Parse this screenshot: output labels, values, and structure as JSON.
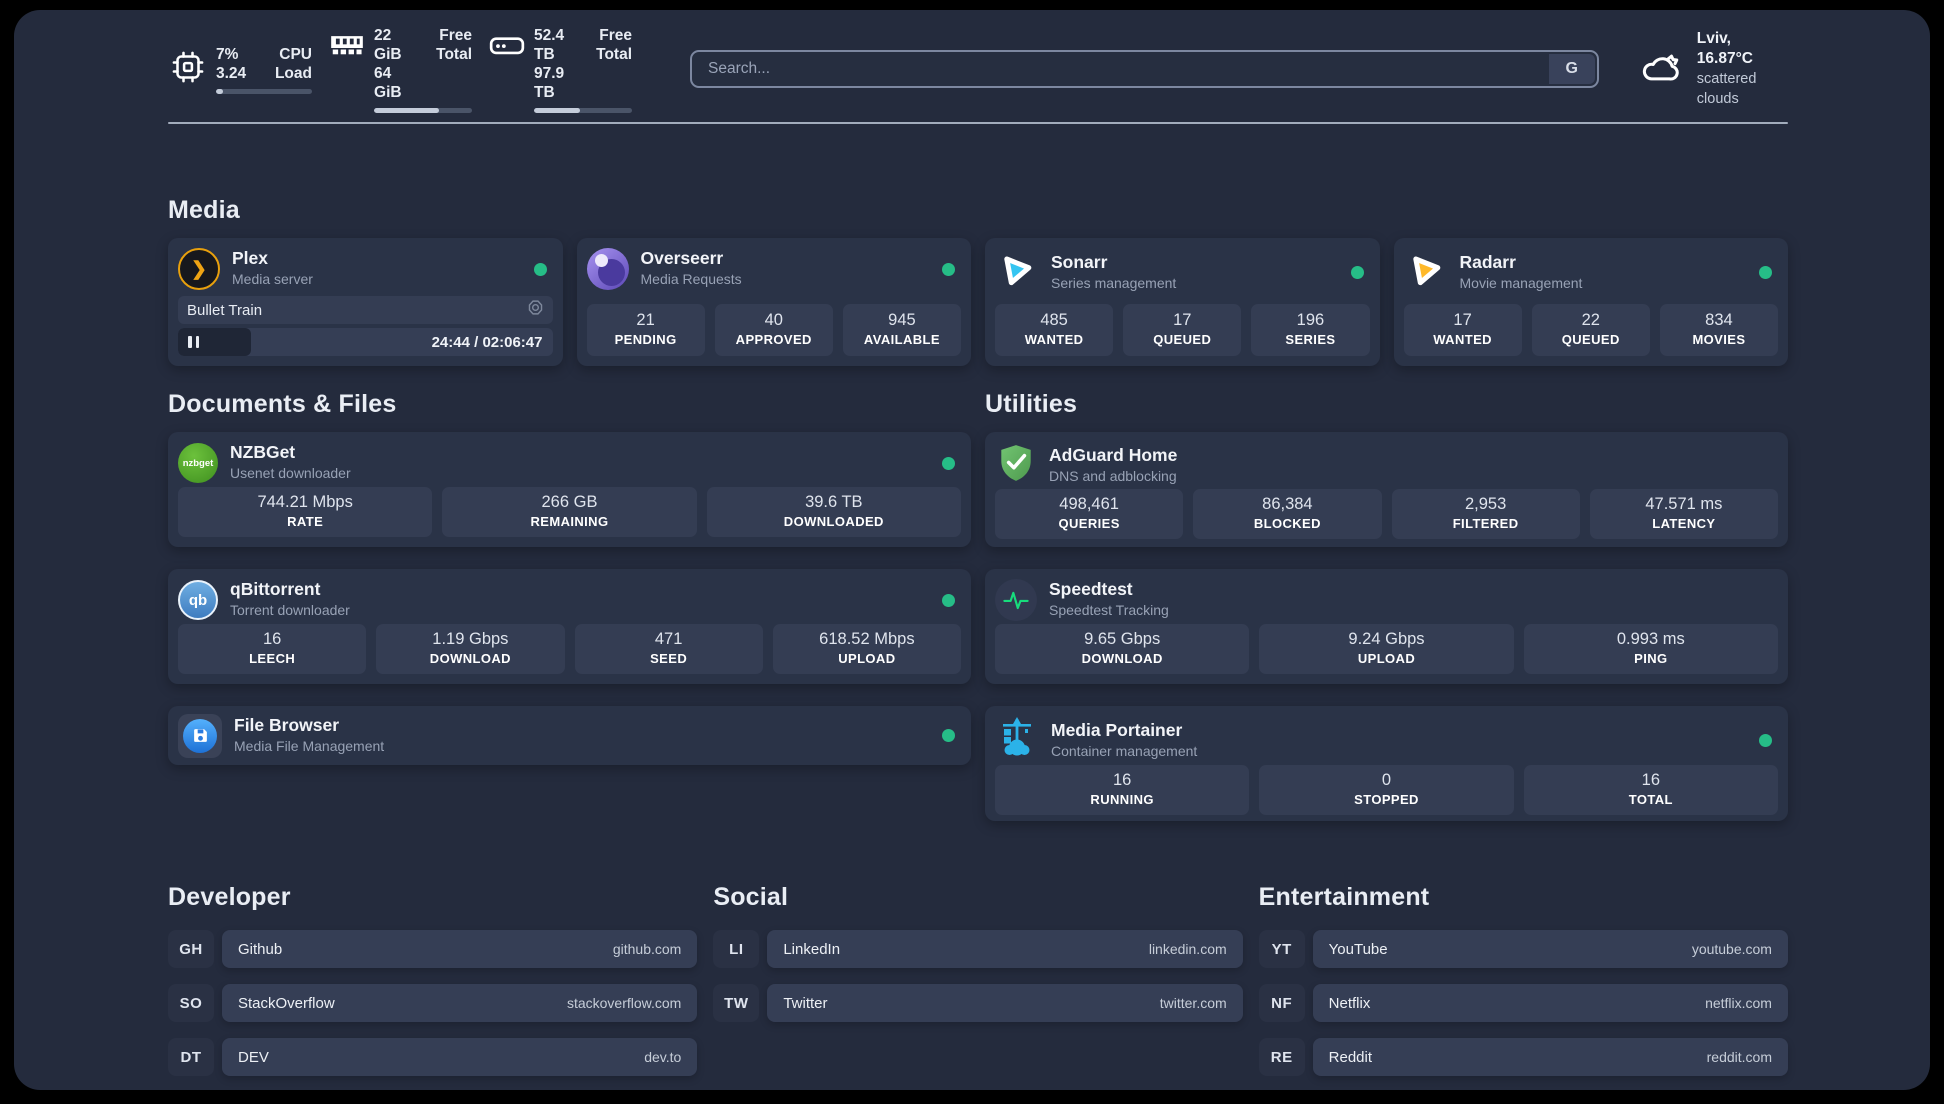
{
  "header": {
    "stats": [
      {
        "icon": "cpu-icon",
        "values": [
          "7%",
          "3.24"
        ],
        "labels": [
          "CPU",
          "Load"
        ],
        "progress_pct": 7
      },
      {
        "icon": "ram-icon",
        "values": [
          "22 GiB",
          "64 GiB"
        ],
        "labels": [
          "Free",
          "Total"
        ],
        "progress_pct": 66
      },
      {
        "icon": "disk-icon",
        "values": [
          "52.4 TB",
          "97.9 TB"
        ],
        "labels": [
          "Free",
          "Total"
        ],
        "progress_pct": 47
      }
    ],
    "search": {
      "placeholder": "Search...",
      "button_label": "G"
    },
    "weather": {
      "icon": "cloud-icon",
      "location_temp": "Lviv, 16.87°C",
      "condition": "scattered clouds"
    }
  },
  "sections": {
    "media": {
      "title": "Media",
      "plex": {
        "name": "Plex",
        "desc": "Media server",
        "status": "online",
        "now_playing": {
          "title": "Bullet Train",
          "time": "24:44 / 02:06:47",
          "progress_pct": 19.5
        }
      },
      "overseerr": {
        "name": "Overseerr",
        "desc": "Media Requests",
        "status": "online",
        "stats": [
          {
            "value": "21",
            "label": "PENDING"
          },
          {
            "value": "40",
            "label": "APPROVED"
          },
          {
            "value": "945",
            "label": "AVAILABLE"
          }
        ]
      },
      "sonarr": {
        "name": "Sonarr",
        "desc": "Series management",
        "status": "online",
        "stats": [
          {
            "value": "485",
            "label": "WANTED"
          },
          {
            "value": "17",
            "label": "QUEUED"
          },
          {
            "value": "196",
            "label": "SERIES"
          }
        ]
      },
      "radarr": {
        "name": "Radarr",
        "desc": "Movie management",
        "status": "online",
        "stats": [
          {
            "value": "17",
            "label": "WANTED"
          },
          {
            "value": "22",
            "label": "QUEUED"
          },
          {
            "value": "834",
            "label": "MOVIES"
          }
        ]
      }
    },
    "documents": {
      "title": "Documents & Files",
      "nzbget": {
        "name": "NZBGet",
        "desc": "Usenet downloader",
        "status": "online",
        "stats": [
          {
            "value": "744.21 Mbps",
            "label": "RATE"
          },
          {
            "value": "266 GB",
            "label": "REMAINING"
          },
          {
            "value": "39.6 TB",
            "label": "DOWNLOADED"
          }
        ]
      },
      "qbittorrent": {
        "name": "qBittorrent",
        "desc": "Torrent downloader",
        "status": "online",
        "stats": [
          {
            "value": "16",
            "label": "LEECH"
          },
          {
            "value": "1.19 Gbps",
            "label": "DOWNLOAD"
          },
          {
            "value": "471",
            "label": "SEED"
          },
          {
            "value": "618.52 Mbps",
            "label": "UPLOAD"
          }
        ]
      },
      "filebrowser": {
        "name": "File Browser",
        "desc": "Media File Management",
        "status": "online"
      }
    },
    "utilities": {
      "title": "Utilities",
      "adguard": {
        "name": "AdGuard Home",
        "desc": "DNS and adblocking",
        "stats": [
          {
            "value": "498,461",
            "label": "QUERIES"
          },
          {
            "value": "86,384",
            "label": "BLOCKED"
          },
          {
            "value": "2,953",
            "label": "FILTERED"
          },
          {
            "value": "47.571 ms",
            "label": "LATENCY"
          }
        ]
      },
      "speedtest": {
        "name": "Speedtest",
        "desc": "Speedtest Tracking",
        "stats": [
          {
            "value": "9.65 Gbps",
            "label": "DOWNLOAD"
          },
          {
            "value": "9.24 Gbps",
            "label": "UPLOAD"
          },
          {
            "value": "0.993 ms",
            "label": "PING"
          }
        ]
      },
      "portainer": {
        "name": "Media Portainer",
        "desc": "Container management",
        "status": "online",
        "stats": [
          {
            "value": "16",
            "label": "RUNNING"
          },
          {
            "value": "0",
            "label": "STOPPED"
          },
          {
            "value": "16",
            "label": "TOTAL"
          }
        ]
      }
    }
  },
  "links": {
    "developer": {
      "title": "Developer",
      "items": [
        {
          "abbr": "GH",
          "name": "Github",
          "url": "github.com"
        },
        {
          "abbr": "SO",
          "name": "StackOverflow",
          "url": "stackoverflow.com"
        },
        {
          "abbr": "DT",
          "name": "DEV",
          "url": "dev.to"
        }
      ]
    },
    "social": {
      "title": "Social",
      "items": [
        {
          "abbr": "LI",
          "name": "LinkedIn",
          "url": "linkedin.com"
        },
        {
          "abbr": "TW",
          "name": "Twitter",
          "url": "twitter.com"
        }
      ]
    },
    "entertainment": {
      "title": "Entertainment",
      "items": [
        {
          "abbr": "YT",
          "name": "YouTube",
          "url": "youtube.com"
        },
        {
          "abbr": "NF",
          "name": "Netflix",
          "url": "netflix.com"
        },
        {
          "abbr": "RE",
          "name": "Reddit",
          "url": "reddit.com"
        }
      ]
    }
  },
  "colors": {
    "status_online": "#26BD87",
    "plex_accent": "#E8A00D",
    "sonarr_accent": "#35C5F1",
    "radarr_accent": "#FFB92A",
    "portainer_accent": "#2BB2E8",
    "speedtest_accent": "#17DC7C",
    "background": "#242B3D",
    "card": "#2A3347"
  }
}
